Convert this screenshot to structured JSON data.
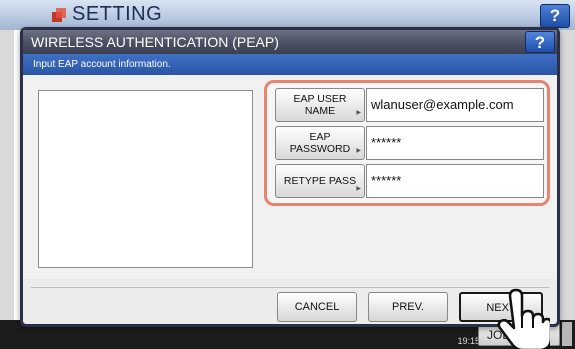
{
  "background": {
    "title": "SETTING",
    "help_label": "?",
    "datetime": "19:15",
    "job_status_label": "JOB S"
  },
  "dialog": {
    "title": "WIRELESS AUTHENTICATION (PEAP)",
    "help_label": "?",
    "instruction": "Input EAP account information.",
    "fields": [
      {
        "button_label_line1": "EAP USER",
        "button_label_line2": "NAME",
        "value": "wlanuser@example.com"
      },
      {
        "button_label_line1": "EAP",
        "button_label_line2": "PASSWORD",
        "value": "******"
      },
      {
        "button_label_line1": "RETYPE PASS",
        "button_label_line2": "",
        "value": "******"
      }
    ],
    "buttons": {
      "cancel": "CANCEL",
      "prev": "PREV.",
      "next": "NEXT"
    }
  },
  "colors": {
    "title_bar": "#4e5266",
    "instruction_bar": "#3e6fc4",
    "field_group_outline": "#e6846e",
    "help_button": "#2a5bb8"
  },
  "icons": {
    "logo": "setting-logo-icon",
    "pointer": "hand-pointer-icon"
  }
}
